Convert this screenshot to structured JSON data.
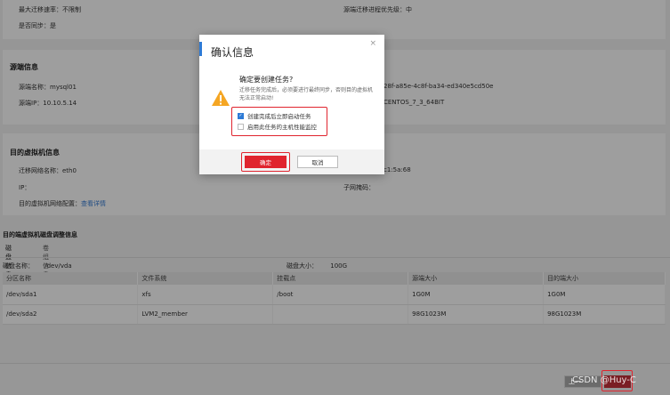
{
  "top": {
    "max_rate": "最大迁移速率：不限制",
    "priority": "源端迁移进程优先级：中",
    "sync": "是否同步：是"
  },
  "source": {
    "title": "源端信息",
    "name": "源端名称：mysql01",
    "ip": "源端IP：10.10.5.14",
    "id_fragment": "28f-a85e-4c8f-ba34-ed340e5cd50e",
    "os_fragment": "CENTOS_7_3_64BIT"
  },
  "target": {
    "title": "目的虚拟机信息",
    "nic": "迁移网络名称：eth0",
    "ip": "IP：",
    "mac_fragment": "c1:5a:68",
    "subnet": "子网掩码：",
    "config_label": "目的虚拟机网络配置：",
    "config_link": "查看详情"
  },
  "disk": {
    "title": "目的端虚拟机磁盘调整信息",
    "tabs": [
      "磁盘信息",
      "卷组信息"
    ],
    "name_label": "磁盘名称：",
    "name_value": "/dev/vda",
    "size_label": "磁盘大小：",
    "size_value": "100G",
    "columns": [
      "分区名称",
      "文件系统",
      "挂载点",
      "源端大小",
      "目的端大小"
    ],
    "rows": [
      [
        "/dev/sda1",
        "xfs",
        "/boot",
        "1G0M",
        "1G0M"
      ],
      [
        "/dev/sda2",
        "LVM2_member",
        "",
        "98G1023M",
        "98G1023M"
      ]
    ]
  },
  "footer": {
    "prev": "上一",
    "watermark": "CSDN @Huy-C"
  },
  "dialog": {
    "title": "确认信息",
    "close": "×",
    "question": "确定要创建任务?",
    "description": "迁移任务完成后，必须要进行最终同步，否则目的虚拟机无法正常启动!",
    "opt_start": "创建完成后立即启动任务",
    "opt_monitor": "启用此任务的主机性能监控",
    "ok": "确定",
    "cancel": "取消"
  },
  "colors": {
    "accent": "#2e7bd6",
    "danger": "#e0242e"
  }
}
